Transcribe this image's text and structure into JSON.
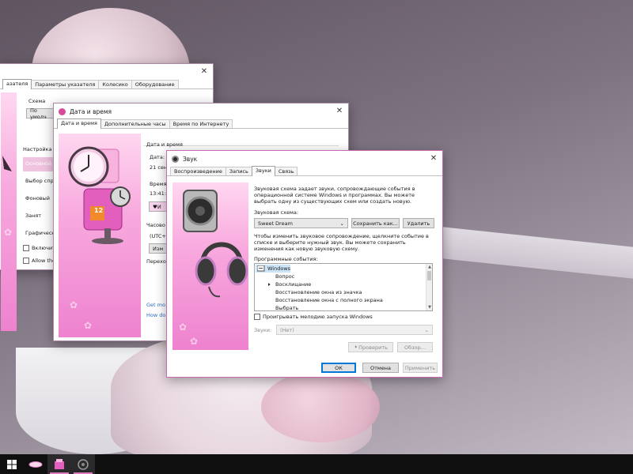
{
  "colors": {
    "accent": "#e07bbf",
    "pink_panel_top": "#ffd7f0",
    "pink_panel_bottom": "#ee82cf",
    "taskbar": "#0f0f10",
    "link": "#2b6fc2"
  },
  "mouse_window": {
    "tab_left": "азателя",
    "tabs": [
      "Параметры указателя",
      "Колесико",
      "Оборудование"
    ],
    "scheme_label": "Схема",
    "scheme_value": "По умолч",
    "settings_label": "Настройка",
    "list_items": [
      "Основной",
      "Выбор спр",
      "Фоновый",
      "Занят",
      "Графическ"
    ],
    "checks": [
      "Включит",
      "Allow the"
    ]
  },
  "datetime_window": {
    "title": "Дата и время",
    "tabs": [
      "Дата и время",
      "Дополнительные часы",
      "Время по Интернету"
    ],
    "group_title": "Дата и время",
    "date_label": "Дата:",
    "date_value": "21 сен",
    "time_label": "Время",
    "time_value": "13:41:3",
    "change_btn": "И",
    "tz_label": "Часово",
    "tz_value": "(UTC+0",
    "tz_btn": "Изм",
    "dst_label": "Перехо",
    "link1": "Get mo",
    "link2": "How do",
    "calendar_number": "12"
  },
  "sound_window": {
    "title": "Звук",
    "tabs": [
      "Воспроизведение",
      "Запись",
      "Звуки",
      "Связь"
    ],
    "active_tab": 2,
    "description": "Звуковая схема задает звуки, сопровождающие события в операционной системе Windows и программах. Вы можете выбрать одну из существующих схем или создать новую.",
    "scheme_label": "Звуковая схема:",
    "scheme_value": "Sweet Dream",
    "save_as_btn": "Сохранить как...",
    "delete_btn": "Удалить",
    "change_description": "Чтобы изменить звуковое сопровождение, щелкните событие в списке и выберите нужный звук. Вы можете сохранить изменения как новую звуковую схему.",
    "events_label": "Программные события:",
    "events": [
      "Windows",
      "Вопрос",
      "Восклицание",
      "Восстановление окна из значка",
      "Восстановление окна с полного экрана",
      "Выбрать"
    ],
    "startup_checkbox": "Проигрывать мелодию запуска Windows",
    "sounds_label": "Звуки:",
    "sounds_value": "(Нет)",
    "test_btn": "Проверить",
    "browse_btn": "Обзор...",
    "ok_btn": "ОК",
    "cancel_btn": "Отмена",
    "apply_btn": "Применить"
  },
  "taskbar": {
    "items": [
      "windows-start-icon",
      "eraser-app-icon",
      "pink-box-app-icon",
      "sound-app-icon"
    ]
  }
}
